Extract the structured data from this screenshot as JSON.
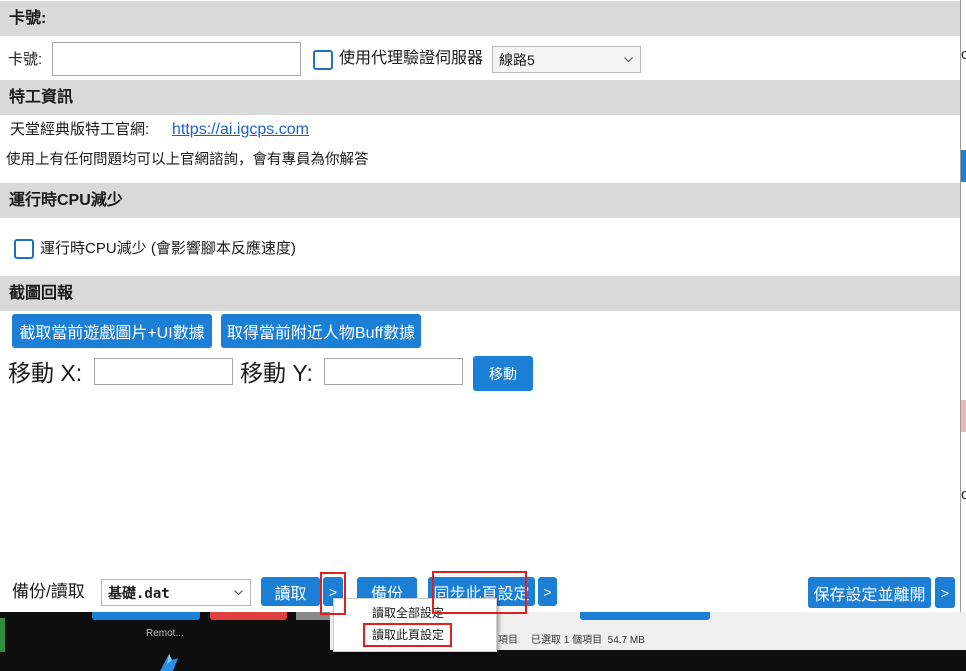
{
  "colors": {
    "accent": "#1b7fd6",
    "section_bar": "#d9d9d9",
    "link": "#1a64c8",
    "highlight": "#e02020"
  },
  "card": {
    "title": "卡號:",
    "label": "卡號:",
    "value": "",
    "proxy_label": "使用代理驗證伺服器",
    "proxy_checked": false,
    "route_selected": "線路5"
  },
  "agent": {
    "title": "特工資訊",
    "site_label": "天堂經典版特工官網:",
    "site_link": "https://ai.igcps.com",
    "note": "使用上有任何問題均可以上官網諮詢，會有專員為你解答"
  },
  "cpu": {
    "title": "運行時CPU減少",
    "checkbox_label": "運行時CPU減少 (會影響腳本反應速度)",
    "checked": false
  },
  "screenshot": {
    "title": "截圖回報",
    "capture_button": "截取當前遊戲圖片+UI數據",
    "buff_button": "取得當前附近人物Buff數據",
    "move_x_label": "移動 X:",
    "move_x_value": "",
    "move_y_label": "移動 Y:",
    "move_y_value": "",
    "move_button": "移動"
  },
  "footer": {
    "backup_label": "備份/讀取",
    "file_selected": "基礎.dat",
    "load_button": "讀取",
    "more_label": ">",
    "backup_button": "備份",
    "sync_button": "同步此頁設定",
    "save_exit_button": "保存設定並離開"
  },
  "context_menu": {
    "items": [
      {
        "label": "讀取全部設定"
      },
      {
        "label": "讀取此頁設定"
      }
    ]
  },
  "background": {
    "status_items": "項目",
    "status_selected": "已選取 1 個項目  54.7 MB",
    "taskbar_label": "Remot...",
    "right_fragments": [
      "c",
      "oi"
    ]
  }
}
